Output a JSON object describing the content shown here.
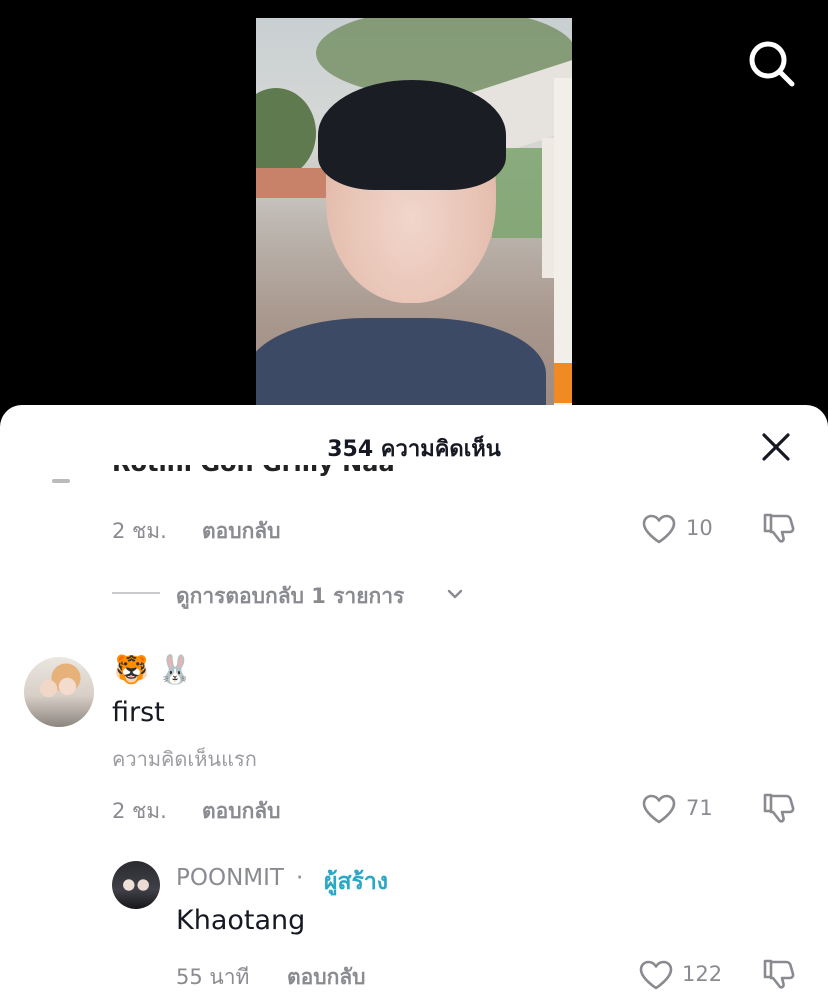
{
  "search": {
    "icon": "search-icon"
  },
  "sheet": {
    "title": "354 ความคิดเห็น",
    "close_icon": "close-icon"
  },
  "cut_comment": {
    "text": "Rotini Gon Grilly Naa",
    "time": "2 ชม.",
    "reply": "ตอบกลับ",
    "likes": "10"
  },
  "view_replies": {
    "label": "ดูการตอบกลับ 1 รายการ"
  },
  "comment1": {
    "emojis": "🐯 🐰",
    "text": "first",
    "sub": "ความคิดเห็นแรก",
    "time": "2 ชม.",
    "reply": "ตอบกลับ",
    "likes": "71"
  },
  "reply1": {
    "username": "POONMIT",
    "dot": " · ",
    "badge": "ผู้สร้าง",
    "text": "Khaotang",
    "time": "55 นาที",
    "reply": "ตอบกลับ",
    "likes": "122"
  },
  "colors": {
    "creator": "#2aa7c4",
    "muted": "#8a8b91",
    "text": "#161823"
  }
}
